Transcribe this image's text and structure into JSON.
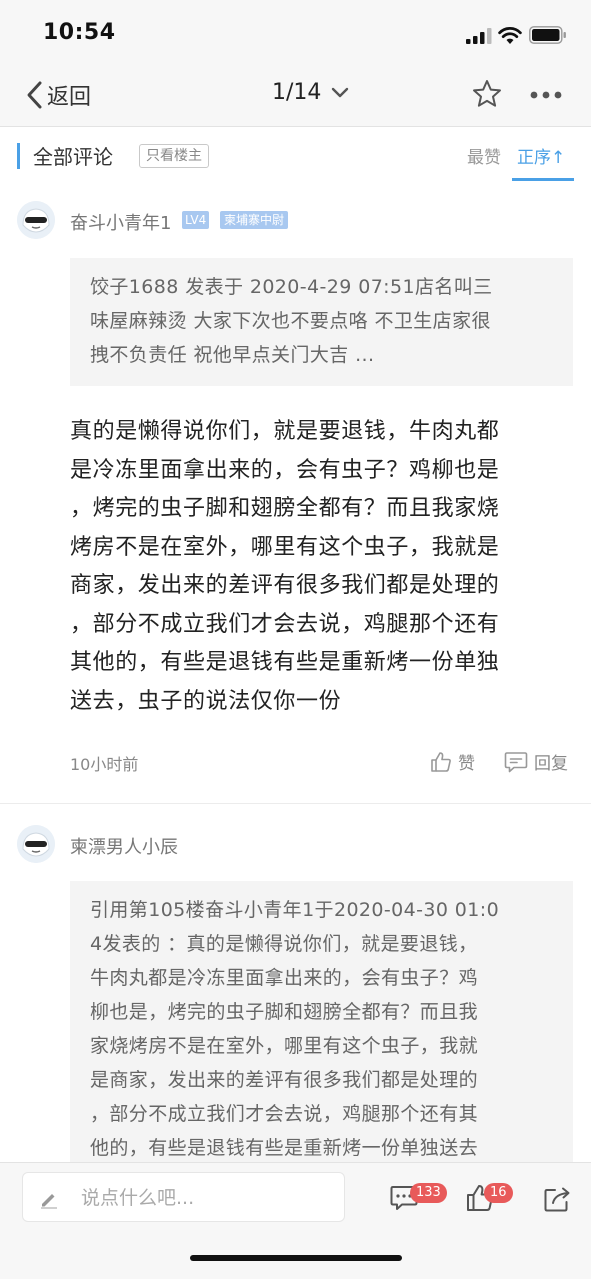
{
  "status": {
    "time": "10:54"
  },
  "nav": {
    "back_label": "返回",
    "page": "1/14"
  },
  "comment_header": {
    "title": "全部评论",
    "only_op": "只看楼主",
    "sort_hot": "最赞",
    "sort_order": "正序↑"
  },
  "posts": [
    {
      "user": "奋斗小青年1",
      "level": "LV4",
      "tag": "柬埔寨中尉",
      "quote_lines": [
        "饺子1688 发表于 2020-4-29 07:51店名叫三",
        "味屋麻辣烫 大家下次也不要点咯 不卫生店家很",
        "拽不负责任 祝他早点关门大吉 ..."
      ],
      "body_lines": [
        "真的是懒得说你们，就是要退钱，牛肉丸都",
        "是冷冻里面拿出来的，会有虫子？鸡柳也是",
        "，烤完的虫子脚和翅膀全都有？而且我家烧",
        "烤房不是在室外，哪里有这个虫子，我就是",
        "商家，发出来的差评有很多我们都是处理的",
        "，部分不成立我们才会去说，鸡腿那个还有",
        "其他的，有些是退钱有些是重新烤一份单独",
        "送去，虫子的说法仅你一份"
      ],
      "time": "10小时前",
      "like_label": "赞",
      "reply_label": "回复"
    },
    {
      "user": "柬漂男人小辰",
      "quote_lines": [
        "引用第105楼奋斗小青年1于2020-04-30 01:0",
        "4发表的 ：真的是懒得说你们，就是要退钱，",
        "牛肉丸都是冷冻里面拿出来的，会有虫子？鸡",
        "柳也是，烤完的虫子脚和翅膀全都有？而且我",
        "家烧烤房不是在室外，哪里有这个虫子，我就",
        "是商家，发出来的差评有很多我们都是处理的",
        "，部分不成立我们才会去说，鸡腿那个还有其",
        "他的，有些是退钱有些是重新烤一份单独送去"
      ]
    }
  ],
  "bottom": {
    "input_placeholder": "说点什么吧...",
    "comment_count": "133",
    "like_count": "16"
  }
}
